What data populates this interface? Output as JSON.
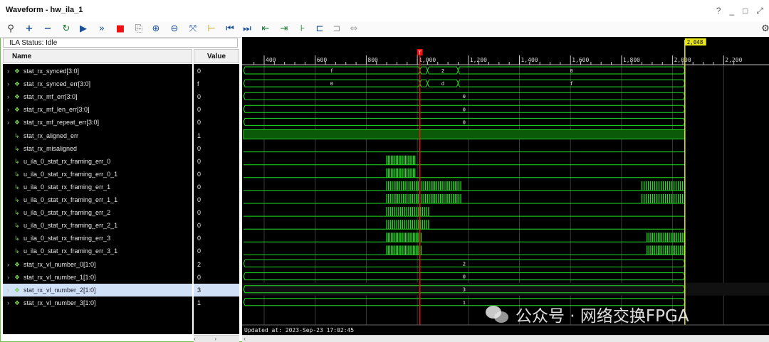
{
  "window": {
    "title": "Waveform - hw_ila_1",
    "buttons": [
      "?",
      "_",
      "□",
      "⤢"
    ]
  },
  "toolbar": {
    "icons": [
      "search-icon",
      "add-icon",
      "remove-icon",
      "refresh-icon",
      "run-icon",
      "run-all-icon",
      "stop-icon",
      "export-icon",
      "zoom-in-icon",
      "zoom-out-icon",
      "zoom-fit-icon",
      "marker-icon",
      "go-first-icon",
      "go-last-icon",
      "add-marker-icon",
      "next-marker-icon",
      "add-cursor-icon",
      "prev-transition-icon",
      "next-transition-icon",
      "swap-icon"
    ],
    "settings_icon": "gear-icon"
  },
  "ila_status": "ILA Status:  Idle",
  "columns": {
    "name": "Name",
    "value": "Value"
  },
  "signals": [
    {
      "name": "stat_rx_synced[3:0]",
      "value": "0",
      "bus": true
    },
    {
      "name": "stat_rx_synced_err[3:0]",
      "value": "f",
      "bus": true
    },
    {
      "name": "stat_rx_mf_err[3:0]",
      "value": "0",
      "bus": true
    },
    {
      "name": "stat_rx_mf_len_err[3:0]",
      "value": "0",
      "bus": true
    },
    {
      "name": "stat_rx_mf_repeat_err[3:0]",
      "value": "0",
      "bus": true
    },
    {
      "name": "stat_rx_aligned_err",
      "value": "1",
      "bus": false
    },
    {
      "name": "stat_rx_misaligned",
      "value": "0",
      "bus": false
    },
    {
      "name": "u_ila_0_stat_rx_framing_err_0",
      "value": "0",
      "bus": false
    },
    {
      "name": "u_ila_0_stat_rx_framing_err_0_1",
      "value": "0",
      "bus": false
    },
    {
      "name": "u_ila_0_stat_rx_framing_err_1",
      "value": "0",
      "bus": false
    },
    {
      "name": "u_ila_0_stat_rx_framing_err_1_1",
      "value": "0",
      "bus": false
    },
    {
      "name": "u_ila_0_stat_rx_framing_err_2",
      "value": "0",
      "bus": false
    },
    {
      "name": "u_ila_0_stat_rx_framing_err_2_1",
      "value": "0",
      "bus": false
    },
    {
      "name": "u_ila_0_stat_rx_framing_err_3",
      "value": "0",
      "bus": false
    },
    {
      "name": "u_ila_0_stat_rx_framing_err_3_1",
      "value": "0",
      "bus": false
    },
    {
      "name": "stat_rx_vl_number_0[1:0]",
      "value": "2",
      "bus": true
    },
    {
      "name": "stat_rx_vl_number_1[1:0]",
      "value": "0",
      "bus": true
    },
    {
      "name": "stat_rx_vl_number_2[1:0]",
      "value": "3",
      "bus": true,
      "selected": true
    },
    {
      "name": "stat_rx_vl_number_3[1:0]",
      "value": "1",
      "bus": true
    }
  ],
  "timeline": {
    "ticks": [
      "400",
      "600",
      "800",
      "1,000",
      "1,200",
      "1,400",
      "1,600",
      "1,800",
      "2,000",
      "2,200"
    ],
    "trigger_label": "T",
    "cursor_label": "2,048"
  },
  "bus_labels": {
    "synced": [
      "f",
      "2",
      "0"
    ],
    "synced_err": [
      "0",
      "d",
      "f"
    ],
    "mf_err": "0",
    "mf_len_err": "0",
    "mf_repeat_err": "0",
    "vl_number_0": "2",
    "vl_number_1": "0",
    "vl_number_2": "3",
    "vl_number_3": "1"
  },
  "updated_at": "Updated at: 2023-Sep-23 17:02:45",
  "watermark": "公众号 · 网络交换FPGA",
  "colors": {
    "wave": "#22dd22",
    "wave_fill": "#0a5a0a",
    "trigger": "#e11",
    "cursor": "#e6e61a"
  }
}
